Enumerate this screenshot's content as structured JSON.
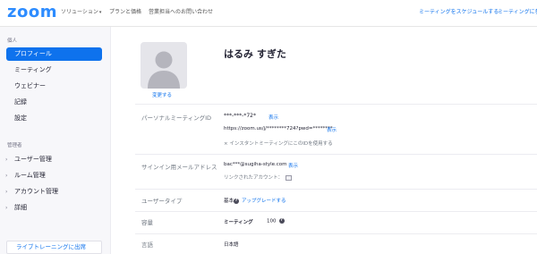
{
  "header": {
    "logo": "zoom",
    "nav": {
      "solutions": "ソリューション",
      "plans": "プランと価格",
      "contact_sales": "営業担当へのお問い合わせ"
    },
    "right": {
      "schedule": "ミーティングをスケジュールする",
      "join": "ミーティングに参加"
    }
  },
  "sidebar": {
    "personal_heading": "個人",
    "items": [
      {
        "label": "プロフィール"
      },
      {
        "label": "ミーティング"
      },
      {
        "label": "ウェビナー"
      },
      {
        "label": "記録"
      },
      {
        "label": "設定"
      }
    ],
    "admin_heading": "管理者",
    "admin_items": [
      {
        "label": "ユーザー管理"
      },
      {
        "label": "ルーム管理"
      },
      {
        "label": "アカウント管理"
      },
      {
        "label": "詳細"
      }
    ],
    "live_training": "ライブトレーニングに出席"
  },
  "profile": {
    "change": "変更する",
    "name": "はるみ すぎた",
    "pmi": {
      "label": "パーソナルミーティングID",
      "value": "***-***-*72*",
      "show": "表示",
      "url": "https://zoom.us/j/********724?pwd=********",
      "url_show": "表示",
      "instant": "× インスタントミーティングにこのIDを使用する"
    },
    "email": {
      "label": "サインイン用メールアドレス",
      "value": "bac***@sugiha-style.com",
      "show": "表示",
      "linked": "リンクされたアカウント："
    },
    "user_type": {
      "label": "ユーザータイプ",
      "value": "基本",
      "upgrade": "アップグレードする"
    },
    "capacity": {
      "label": "容量",
      "meeting": "ミーティング",
      "value": "100"
    },
    "language": {
      "label": "言語",
      "value": "日本語"
    }
  }
}
